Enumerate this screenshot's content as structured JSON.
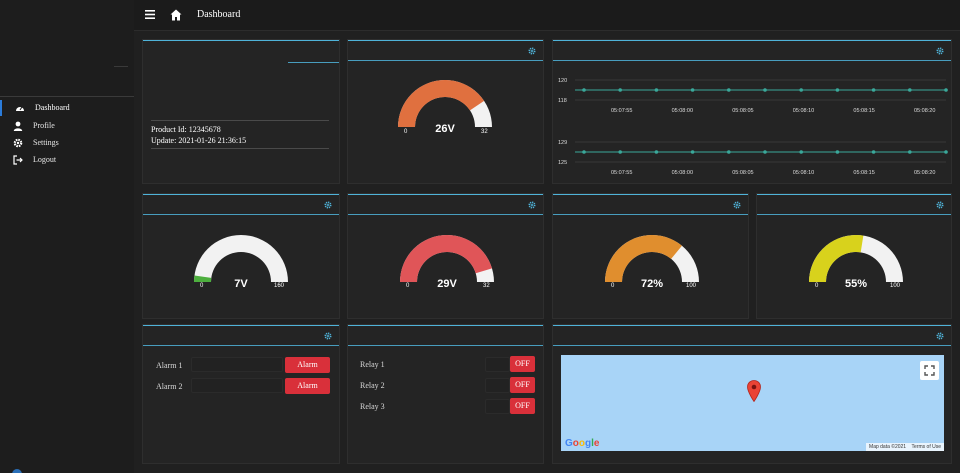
{
  "header": {
    "title": "Dashboard"
  },
  "sidebar": {
    "items": [
      {
        "label": "Dashboard",
        "icon": "dashboard-icon",
        "active": true
      },
      {
        "label": "Profile",
        "icon": "user-icon"
      },
      {
        "label": "Settings",
        "icon": "gear-icon"
      },
      {
        "label": "Logout",
        "icon": "logout-icon"
      }
    ]
  },
  "info_card": {
    "product_id": "Product Id: 12345678",
    "update": "Update: 2021-01-26 21:36:15"
  },
  "gauges": [
    {
      "value_label": "26V",
      "min": "0",
      "max": "32",
      "value": 26,
      "range": 32,
      "color": "#e0703f"
    },
    {
      "value_label": "7V",
      "min": "0",
      "max": "160",
      "value": 7,
      "range": 160,
      "color": "#4daf3e"
    },
    {
      "value_label": "29V",
      "min": "0",
      "max": "32",
      "value": 29,
      "range": 32,
      "color": "#e05558"
    },
    {
      "value_label": "72%",
      "min": "0",
      "max": "100",
      "value": 72,
      "range": 100,
      "color": "#e08e2e"
    },
    {
      "value_label": "55%",
      "min": "0",
      "max": "100",
      "value": 55,
      "range": 100,
      "color": "#d8d21c"
    }
  ],
  "charts": [
    {
      "y_ticks": [
        "120",
        "118"
      ],
      "x_ticks": [
        "05:07:55",
        "05:08:00",
        "05:08:05",
        "05:08:10",
        "05:08:15",
        "05:08:20"
      ]
    },
    {
      "y_ticks": [
        "129",
        "125"
      ],
      "x_ticks": [
        "05:07:55",
        "05:08:00",
        "05:08:05",
        "05:08:10",
        "05:08:15",
        "05:08:20"
      ]
    }
  ],
  "alarms": [
    {
      "label": "Alarm 1",
      "button": "Alarm"
    },
    {
      "label": "Alarm 2",
      "button": "Alarm"
    }
  ],
  "relays": [
    {
      "label": "Relay 1",
      "state": "OFF"
    },
    {
      "label": "Relay 2",
      "state": "OFF"
    },
    {
      "label": "Relay 3",
      "state": "OFF"
    }
  ],
  "map": {
    "logo": "Google",
    "map_data": "Map data ©2021",
    "terms": "Terms of Use"
  },
  "colors": {
    "accent": "#4fb3d9",
    "danger": "#d9303a",
    "series": "#3aa89a"
  }
}
